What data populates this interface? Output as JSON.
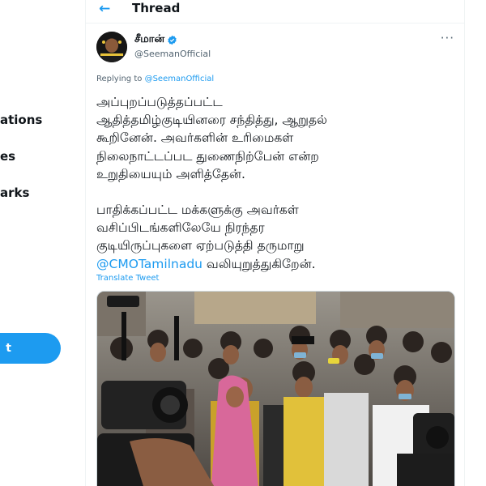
{
  "nav": {
    "items": [
      {
        "label": "ations"
      },
      {
        "label": "es"
      },
      {
        "label": "arks"
      }
    ],
    "tweet_button_label": "t"
  },
  "header": {
    "title": "Thread",
    "back_icon": "back-arrow-icon"
  },
  "tweet": {
    "display_name": "சீமான்",
    "handle": "@SeemanOfficial",
    "verified_icon": "verified-badge-icon",
    "more_icon": "more-options-icon",
    "replying_prefix": "Replying to",
    "replying_to": "@SeemanOfficial",
    "paragraph1_lines": [
      "அப்புறப்படுத்தப்பட்ட",
      "ஆதித்தமிழ்குடியினரை சந்தித்து, ஆறுதல்",
      "கூறினேன். அவர்களின் உரிமைகள்",
      "நிலைநாட்டப்பட துணைநிற்பேன் என்ற",
      "உறுதியையும் அளித்தேன்."
    ],
    "paragraph2_lines": [
      "பாதிக்கப்பட்ட மக்களுக்கு அவர்கள்",
      "வசிப்பிடங்களிலேயே நிரந்தர",
      "குடியிருப்புகளை ஏற்படுத்தி தருமாறு"
    ],
    "mention": "@CMOTamilnadu",
    "last_line_rest": " வலியுறுத்துகிறேன்.",
    "translate_label": "Translate Tweet"
  },
  "colors": {
    "accent": "#1d9bf0",
    "text": "#0f1419",
    "secondary": "#536471"
  }
}
